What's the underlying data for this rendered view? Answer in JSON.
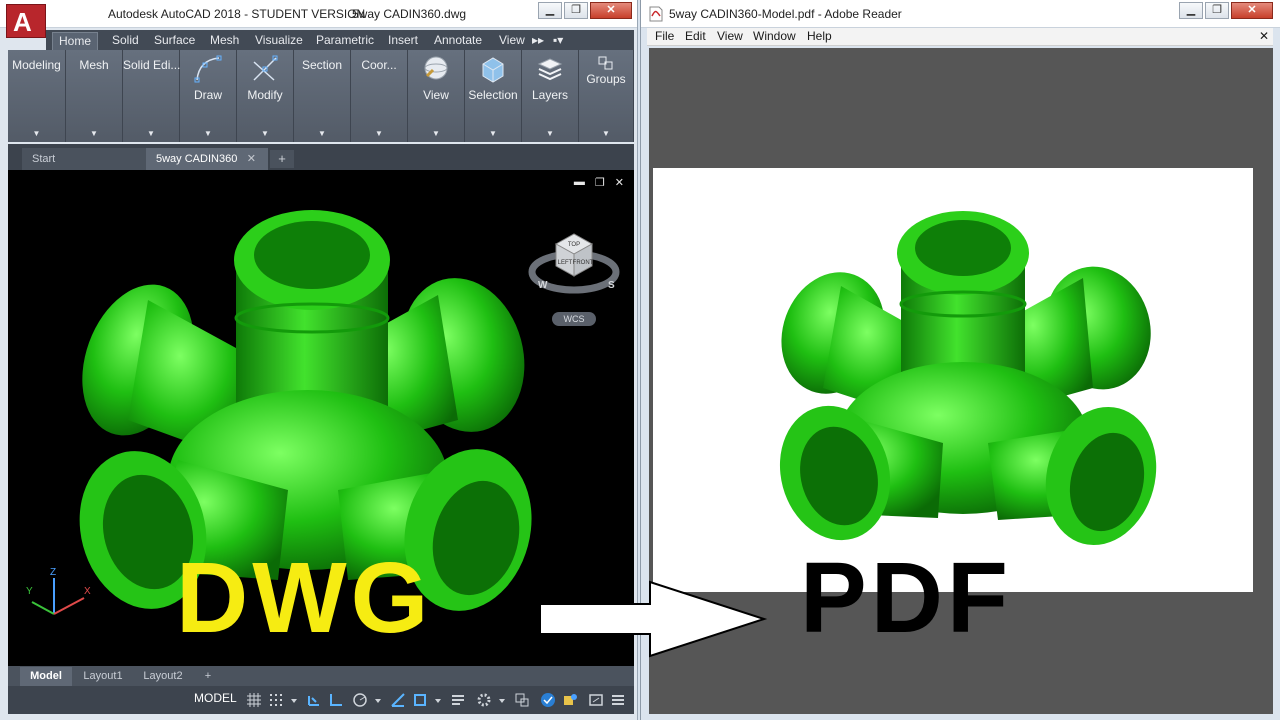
{
  "acad": {
    "title": "Autodesk AutoCAD 2018 - STUDENT VERSION",
    "filename": "5way CADIN360.dwg",
    "app_letter": "A",
    "ribbon_tabs": [
      "Home",
      "Solid",
      "Surface",
      "Mesh",
      "Visualize",
      "Parametric",
      "Insert",
      "Annotate",
      "View"
    ],
    "ribbon_panels": [
      "Modeling",
      "Mesh",
      "Solid Edi...",
      "Draw",
      "Modify",
      "Section",
      "Coor...",
      "View",
      "Selection",
      "Layers",
      "Groups"
    ],
    "file_tabs": [
      "Start",
      "5way CADIN360"
    ],
    "viewcube": {
      "top": "TOP",
      "left": "LEFT",
      "front": "FRONT",
      "w": "W",
      "s": "S",
      "wcs": "WCS"
    },
    "ucs": {
      "x": "X",
      "y": "Y",
      "z": "Z"
    },
    "layout_tabs": [
      "Model",
      "Layout1",
      "Layout2"
    ],
    "status_model": "MODEL"
  },
  "reader": {
    "title": "5way CADIN360-Model.pdf - Adobe Reader",
    "menu": [
      "File",
      "Edit",
      "View",
      "Window",
      "Help"
    ]
  },
  "overlay": {
    "left_text": "DWG",
    "right_text": "PDF"
  },
  "colors": {
    "part_green": "#22c414",
    "dwg_yellow": "#f6ec12",
    "autocad_red": "#b8262c"
  }
}
